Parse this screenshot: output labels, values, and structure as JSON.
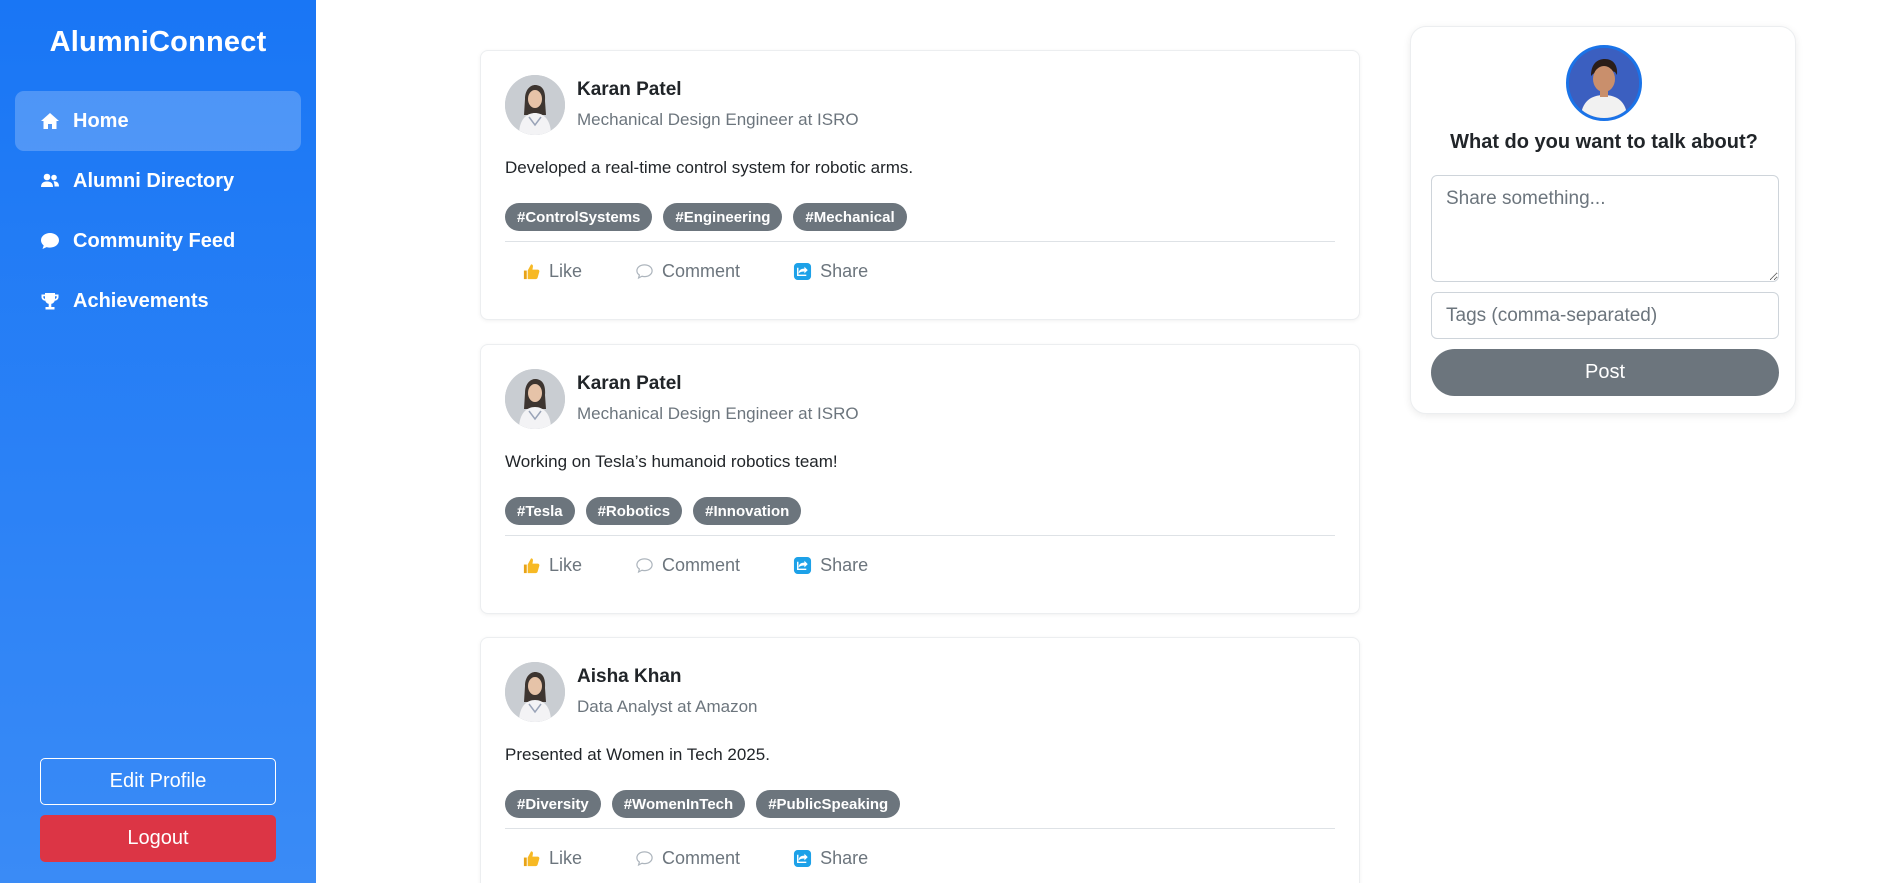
{
  "app": {
    "brand": "AlumniConnect"
  },
  "sidebar": {
    "items": [
      {
        "label": "Home",
        "icon": "home-icon",
        "active": true
      },
      {
        "label": "Alumni Directory",
        "icon": "users-icon",
        "active": false
      },
      {
        "label": "Community Feed",
        "icon": "chat-bubble-icon",
        "active": false
      },
      {
        "label": "Achievements",
        "icon": "trophy-icon",
        "active": false
      }
    ],
    "edit_profile_label": "Edit Profile",
    "logout_label": "Logout"
  },
  "actions": {
    "like": "Like",
    "comment": "Comment",
    "share": "Share"
  },
  "posts": [
    {
      "author": "Karan Patel",
      "role": "Mechanical Design Engineer at ISRO",
      "text": "Developed a real-time control system for robotic arms.",
      "tags": [
        "#ControlSystems",
        "#Engineering",
        "#Mechanical"
      ]
    },
    {
      "author": "Karan Patel",
      "role": "Mechanical Design Engineer at ISRO",
      "text": "Working on Tesla’s humanoid robotics team!",
      "tags": [
        "#Tesla",
        "#Robotics",
        "#Innovation"
      ]
    },
    {
      "author": "Aisha Khan",
      "role": "Data Analyst at Amazon",
      "text": "Presented at Women in Tech 2025.",
      "tags": [
        "#Diversity",
        "#WomenInTech",
        "#PublicSpeaking"
      ]
    }
  ],
  "compose": {
    "title": "What do you want to talk about?",
    "text_placeholder": "Share something...",
    "text_value": "",
    "tags_placeholder": "Tags (comma-separated)",
    "tags_value": "",
    "post_label": "Post"
  },
  "colors": {
    "sidebar_top": "#1976f5",
    "sidebar_bottom": "#3a8bf6",
    "tag_bg": "#6c757d",
    "logout_bg": "#dc3545",
    "post_button_bg": "#6c757d"
  }
}
